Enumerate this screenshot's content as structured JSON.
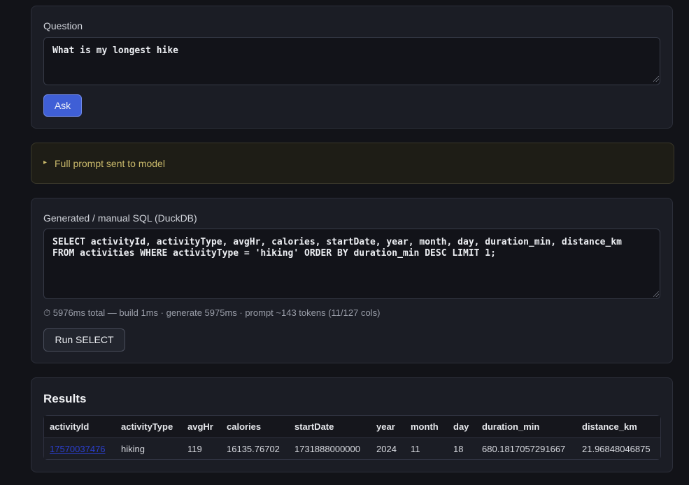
{
  "question": {
    "label": "Question",
    "value": "What is my longest hike",
    "ask_label": "Ask"
  },
  "prompt_details": {
    "summary": "Full prompt sent to model",
    "marker": "▸"
  },
  "sql": {
    "label": "Generated / manual SQL (DuckDB)",
    "value": "SELECT activityId, activityType, avgHr, calories, startDate, year, month, day, duration_min, distance_km\nFROM activities WHERE activityType = 'hiking' ORDER BY duration_min DESC LIMIT 1;",
    "timing": "⏱ 5976ms total — build 1ms · generate 5975ms · prompt ~143 tokens (11/127 cols)",
    "run_label": "Run SELECT"
  },
  "results": {
    "title": "Results",
    "columns": [
      "activityId",
      "activityType",
      "avgHr",
      "calories",
      "startDate",
      "year",
      "month",
      "day",
      "duration_min",
      "distance_km"
    ],
    "rows": [
      [
        "17570037476",
        "hiking",
        "119",
        "16135.76702",
        "1731888000000",
        "2024",
        "11",
        "18",
        "680.1817057291667",
        "21.96848046875"
      ]
    ]
  },
  "colors": {
    "background": "#121318",
    "card": "#1b1d25",
    "accent": "#3f5fd6",
    "details_text": "#c9b96b",
    "link": "#2b3fd0"
  }
}
